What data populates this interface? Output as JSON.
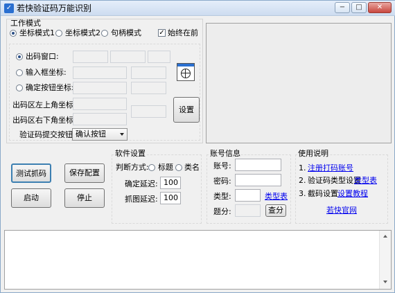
{
  "window": {
    "title": "若快验证码万能识别",
    "minimize_glyph": "−",
    "maximize_glyph": "□",
    "close_glyph": "✕",
    "icon": "app-icon"
  },
  "work_mode": {
    "title": "工作模式",
    "options": [
      "坐标模式1",
      "坐标模式2",
      "句柄模式"
    ],
    "selected": "坐标模式1",
    "always_on_top_label": "始终在前",
    "always_on_top_checked": true
  },
  "coords": {
    "source_window_label": "出码窗口:",
    "input_box_label": "输入框坐标:",
    "confirm_button_label": "确定按钮坐标:",
    "top_left_label": "出码区左上角坐标:",
    "bottom_right_label": "出码区右下角坐标:",
    "submit_label": "验证码提交按钮:",
    "submit_selected": "确认按钮",
    "set_button": "设置",
    "selected_radio": "出码窗口"
  },
  "actions": {
    "test_capture": "测试抓码",
    "save_config": "保存配置",
    "start": "启动",
    "stop": "停止"
  },
  "software": {
    "title": "软件设置",
    "judge_label": "判断方式:",
    "judge_options": [
      "标题",
      "类名"
    ],
    "confirm_delay_label": "确定延迟:",
    "confirm_delay_value": "100",
    "capture_delay_label": "抓图延迟:",
    "capture_delay_value": "100"
  },
  "account": {
    "title": "账号信息",
    "username_label": "账号:",
    "password_label": "密码:",
    "type_label": "类型:",
    "type_link": "类型表",
    "points_label": "题分:",
    "query_button": "查分"
  },
  "usage": {
    "title": "使用说明",
    "step1_prefix": "1.",
    "step1_link": "注册打码账号",
    "step2_prefix": "2.",
    "step2_text": "验证码类型设置",
    "step2_link": "类型表",
    "step3_prefix": "3.",
    "step3_text": "截码设置",
    "step3_link": "设置教程",
    "official_link": "若快官网"
  },
  "colors": {
    "window_bg": "#f0f0f0",
    "link": "#0000ee",
    "titlebar": "#cddcf0"
  }
}
